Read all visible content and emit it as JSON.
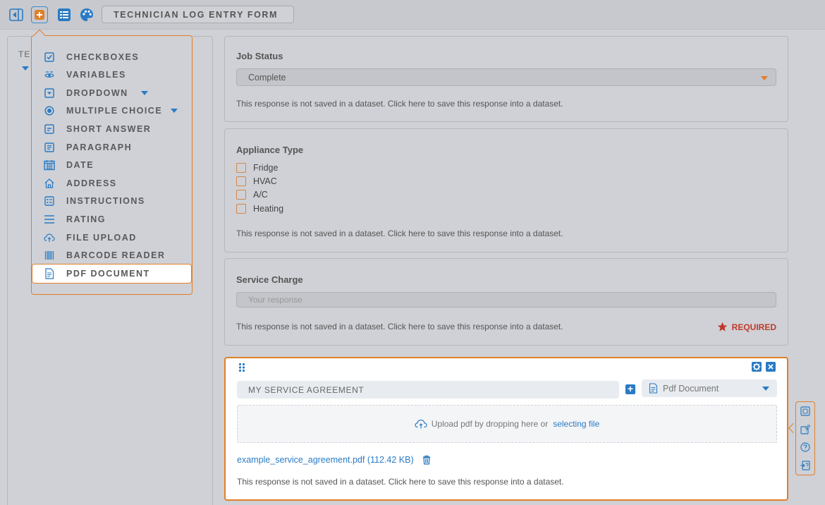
{
  "toolbar": {
    "title": "TECHNICIAN LOG ENTRY FORM",
    "buttons": [
      {
        "icon": "collapse-panel-icon"
      },
      {
        "icon": "add-question-icon"
      },
      {
        "icon": "list-icon"
      },
      {
        "icon": "palette-icon"
      }
    ]
  },
  "left_panel": {
    "label": "TE"
  },
  "question_menu": {
    "items": [
      {
        "label": "CHECKBOXES",
        "icon": "checkbox-icon"
      },
      {
        "label": "VARIABLES",
        "icon": "variables-icon"
      },
      {
        "label": "DROPDOWN",
        "icon": "dropdown-icon"
      },
      {
        "label": "MULTIPLE CHOICE",
        "icon": "radio-icon"
      },
      {
        "label": "SHORT ANSWER",
        "icon": "short-answer-icon"
      },
      {
        "label": "PARAGRAPH",
        "icon": "paragraph-icon"
      },
      {
        "label": "DATE",
        "icon": "calendar-icon"
      },
      {
        "label": "ADDRESS",
        "icon": "home-icon"
      },
      {
        "label": "INSTRUCTIONS",
        "icon": "instructions-icon"
      },
      {
        "label": "RATING",
        "icon": "rating-icon"
      },
      {
        "label": "FILE UPLOAD",
        "icon": "cloud-upload-icon"
      },
      {
        "label": "BARCODE READER",
        "icon": "barcode-icon"
      },
      {
        "label": "PDF DOCUMENT",
        "icon": "pdf-icon"
      }
    ],
    "highlighted": "PDF DOCUMENT"
  },
  "dataset_note": "This response is not saved in a dataset. Click here to save this response into a dataset.",
  "job_status": {
    "title": "Job Status",
    "value": "Complete"
  },
  "appliance_type": {
    "title": "Appliance Type",
    "options": [
      "Fridge",
      "HVAC",
      "A/C",
      "Heating"
    ]
  },
  "service_charge": {
    "title": "Service Charge",
    "placeholder": "Your response",
    "required_label": "REQUIRED"
  },
  "pdf_question": {
    "title_value": "MY SERVICE AGREEMENT",
    "type_value": "Pdf Document",
    "upload_text": "Upload pdf by dropping here or",
    "upload_link": "selecting file",
    "file_name": "example_service_agreement.pdf (112.42 KB)"
  },
  "colors": {
    "accent_orange": "#e07f2a",
    "accent_blue": "#2a7bc4",
    "required_red": "#c0392b"
  }
}
